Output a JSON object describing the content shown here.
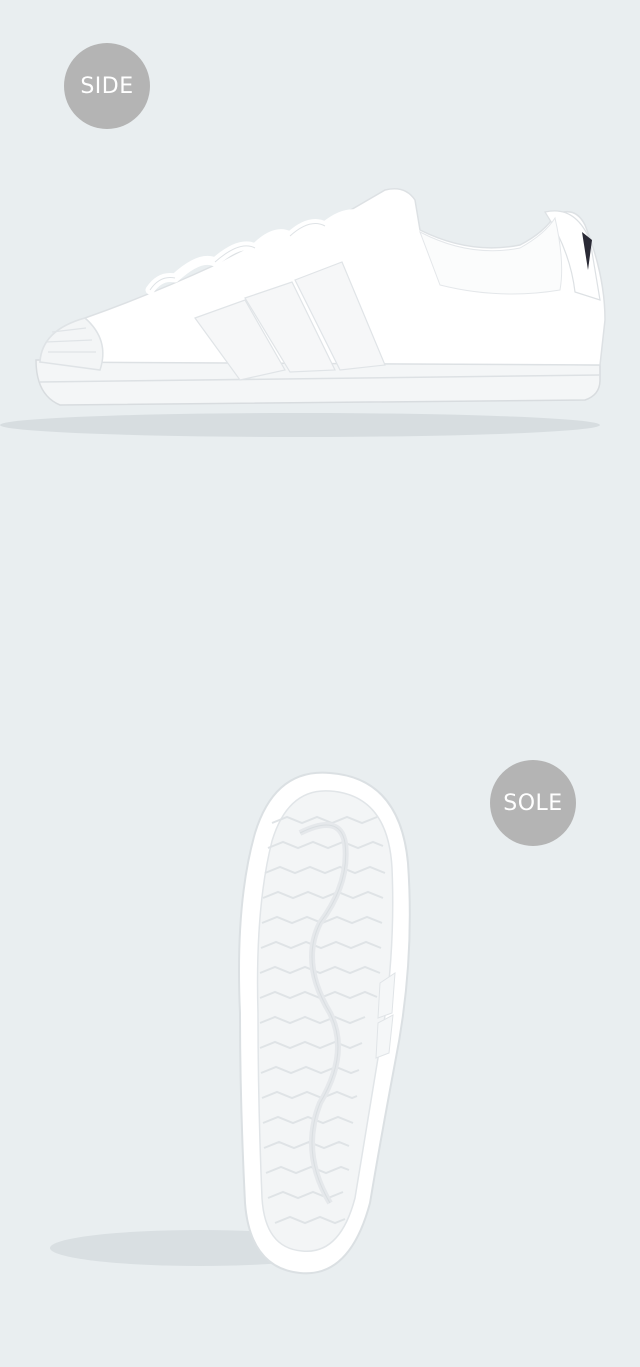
{
  "views": {
    "side": {
      "label": "SIDE",
      "image": "white-sneaker-side-view"
    },
    "sole": {
      "label": "SOLE",
      "image": "white-sneaker-sole-view"
    }
  },
  "colors": {
    "background": "#e9eef0",
    "badge": "#b4b4b4",
    "badge_text": "#ffffff",
    "shoe": "#ffffff",
    "shoe_shade": "#dfe3e6"
  }
}
